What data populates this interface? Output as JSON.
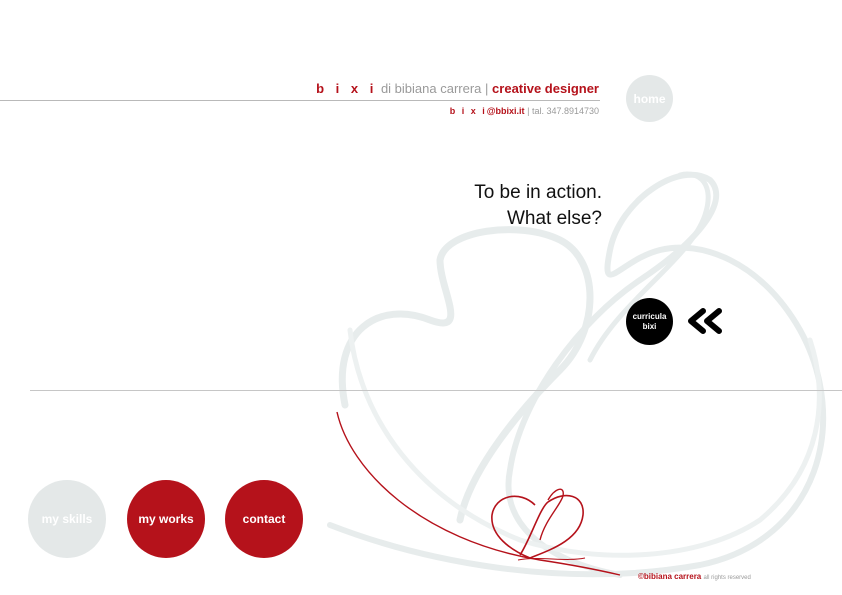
{
  "header": {
    "brand": "b i x i",
    "byline": "di bibiana carrera",
    "separator": "|",
    "role": "creative designer",
    "sub_brand": "b i x i",
    "email": "@bbixi.it",
    "sub_separator": "|",
    "phone": "tal. 347.8914730"
  },
  "nav": {
    "home": "home",
    "skills": "my skills",
    "works": "my works",
    "contact": "contact"
  },
  "tagline": {
    "line1": "To be in action.",
    "line2": "What else?"
  },
  "cv_button": {
    "line1": "curricula",
    "line2": "bixi"
  },
  "icons": {
    "back": "double-chevron-left-icon",
    "art": "heart-swirl-decoration"
  },
  "footer": {
    "name": "©bibiana carrera",
    "rights": "all rights reserved"
  },
  "colors": {
    "brand_red": "#b5121b",
    "light_gray": "#e4e8e8",
    "text_gray": "#9a9a9a"
  }
}
